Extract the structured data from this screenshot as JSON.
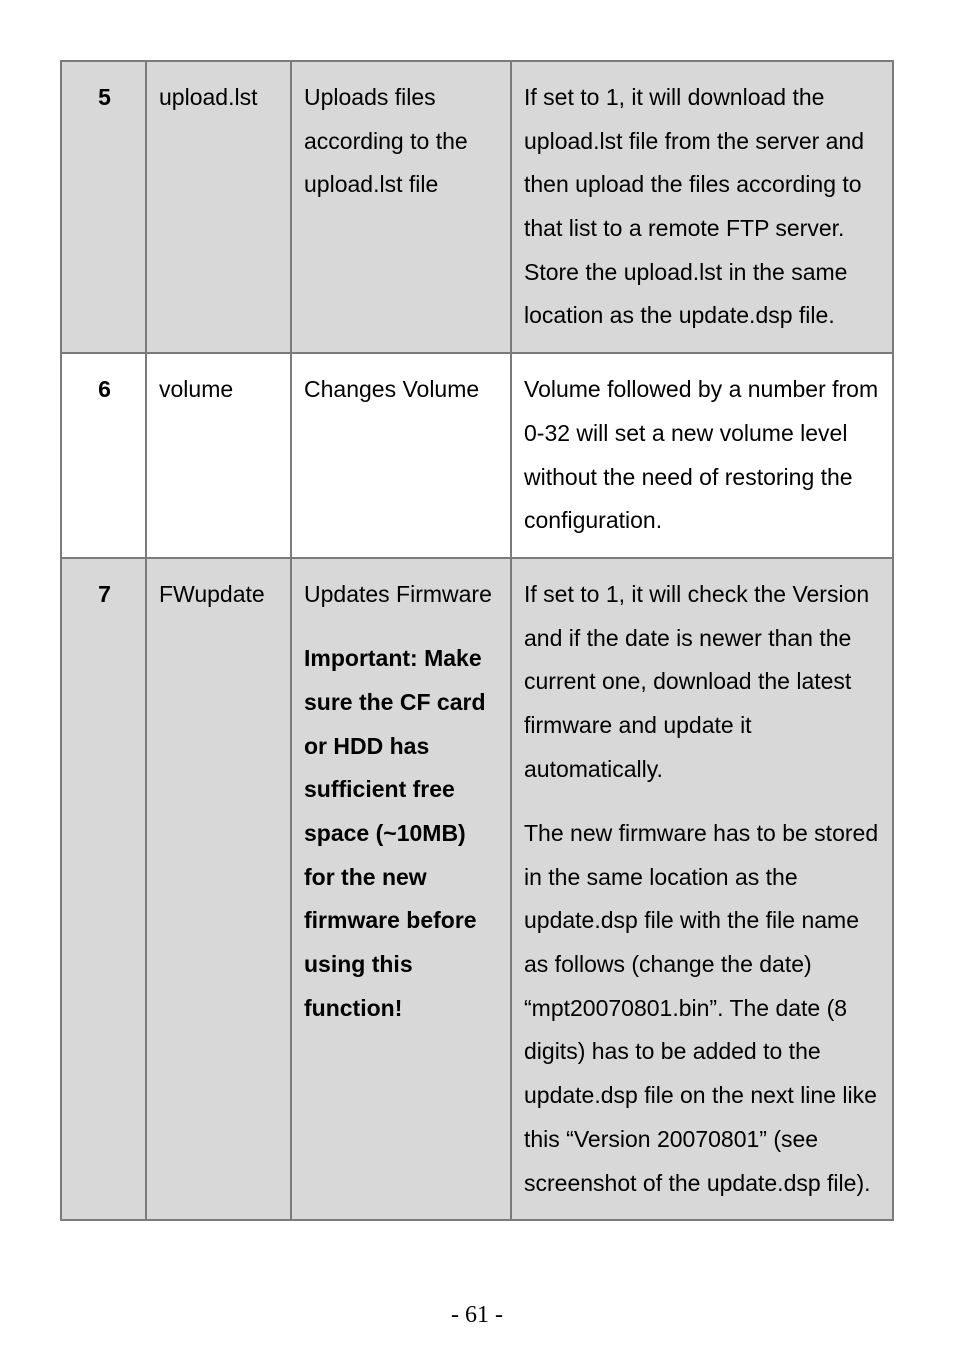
{
  "rows": [
    {
      "num": "5",
      "name": "upload.lst",
      "desc": "Uploads files according to the upload.lst file",
      "detail": "If set to 1, it will download the upload.lst file from the server and then upload the files according to that list to a remote FTP server. Store the upload.lst in the same location as the update.dsp file."
    },
    {
      "num": "6",
      "name": "volume",
      "desc": "Changes Volume",
      "detail": "Volume followed by a number from 0-32 will set a new volume level without the need of restoring the configuration."
    },
    {
      "num": "7",
      "name": "FWupdate",
      "desc_plain": "Updates Firmware",
      "desc_bold": "Important: Make sure the CF card or HDD has sufficient free space (~10MB) for the new firmware before using this function!",
      "detail_p1": "If set to 1, it will check the Version and if the date is newer than the current one, download the latest firmware and update it automatically.",
      "detail_p2": "The new firmware has to be stored in the same location as the update.dsp file with the file name as follows (change the date) “mpt20070801.bin”. The date (8 digits) has to be added to the update.dsp file on the next line like this “Version 20070801” (see screenshot of the update.dsp file)."
    }
  ],
  "page_number": "- 61 -"
}
